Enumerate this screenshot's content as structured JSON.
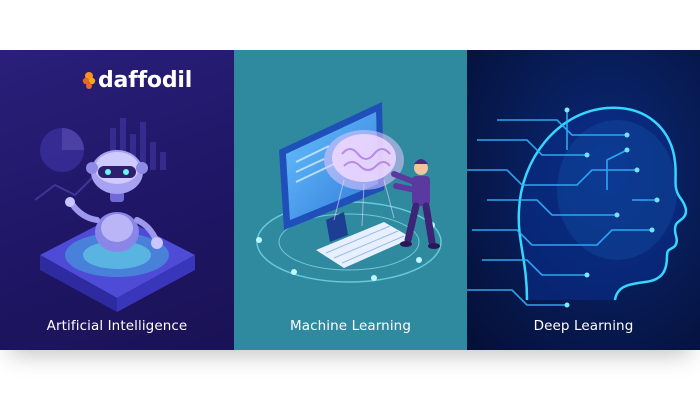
{
  "brand": {
    "name": "daffodil",
    "accent_colors": [
      "#f7941d",
      "#e9672a"
    ]
  },
  "panels": [
    {
      "label": "Artificial Intelligence",
      "icon": "robot-illustration",
      "background": "#211870"
    },
    {
      "label": "Machine Learning",
      "icon": "brain-computer-illustration",
      "background": "#2f8aa0"
    },
    {
      "label": "Deep Learning",
      "icon": "circuit-head-illustration",
      "background": "#071a52"
    }
  ]
}
